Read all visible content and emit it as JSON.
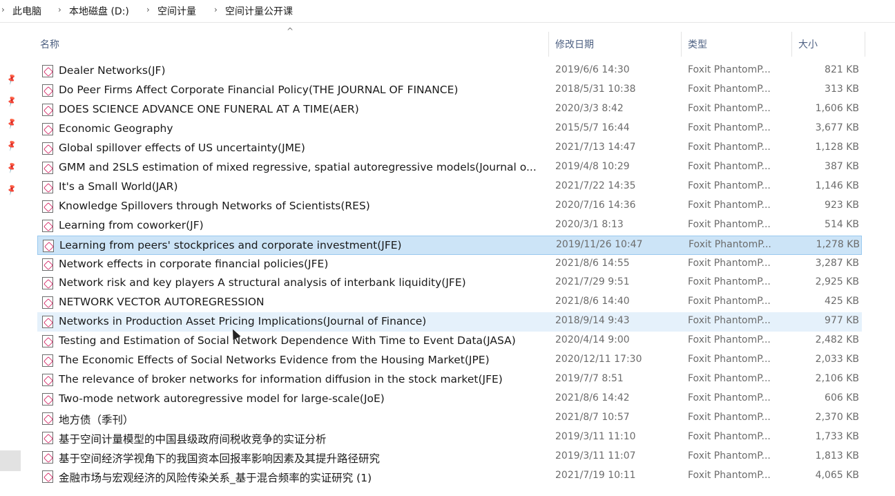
{
  "breadcrumb": [
    "此电脑",
    "本地磁盘 (D:)",
    "空间计量",
    "空间计量公开课"
  ],
  "columns": {
    "name": "名称",
    "date": "修改日期",
    "type": "类型",
    "size": "大小"
  },
  "files": [
    {
      "name": "Dealer Networks(JF)",
      "date": "2019/6/6 14:30",
      "type": "Foxit PhantomP...",
      "size": "821 KB"
    },
    {
      "name": "Do Peer Firms Affect Corporate Financial Policy(THE JOURNAL OF FINANCE)",
      "date": "2018/5/31 10:38",
      "type": "Foxit PhantomP...",
      "size": "313 KB"
    },
    {
      "name": "DOES SCIENCE ADVANCE ONE FUNERAL AT A TIME(AER)",
      "date": "2020/3/3 8:42",
      "type": "Foxit PhantomP...",
      "size": "1,606 KB"
    },
    {
      "name": "Economic Geography",
      "date": "2015/5/7 16:44",
      "type": "Foxit PhantomP...",
      "size": "3,677 KB"
    },
    {
      "name": "Global spillover effects of US uncertainty(JME)",
      "date": "2021/7/13 14:47",
      "type": "Foxit PhantomP...",
      "size": "1,128 KB"
    },
    {
      "name": "GMM and 2SLS estimation of mixed regressive, spatial autoregressive models(Journal o...",
      "date": "2019/4/8 10:29",
      "type": "Foxit PhantomP...",
      "size": "387 KB"
    },
    {
      "name": "It's a Small World(JAR)",
      "date": "2021/7/22 14:35",
      "type": "Foxit PhantomP...",
      "size": "1,146 KB"
    },
    {
      "name": "Knowledge Spillovers through Networks of Scientists(RES)",
      "date": "2020/7/16 14:36",
      "type": "Foxit PhantomP...",
      "size": "923 KB"
    },
    {
      "name": "Learning from coworker(JF)",
      "date": "2020/3/1 8:13",
      "type": "Foxit PhantomP...",
      "size": "514 KB"
    },
    {
      "name": "Learning from peers' stockprices and corporate investment(JFE)",
      "date": "2019/11/26 10:47",
      "type": "Foxit PhantomP...",
      "size": "1,278 KB"
    },
    {
      "name": "Network effects in corporate financial policies(JFE)",
      "date": "2021/8/6 14:55",
      "type": "Foxit PhantomP...",
      "size": "3,287 KB"
    },
    {
      "name": "Network risk and key players A structural analysis of interbank liquidity(JFE)",
      "date": "2021/7/29 9:51",
      "type": "Foxit PhantomP...",
      "size": "2,925 KB"
    },
    {
      "name": "NETWORK VECTOR AUTOREGRESSION",
      "date": "2021/8/6 14:40",
      "type": "Foxit PhantomP...",
      "size": "425 KB"
    },
    {
      "name": "Networks in Production Asset Pricing Implications(Journal of Finance)",
      "date": "2018/9/14 9:43",
      "type": "Foxit PhantomP...",
      "size": "977 KB"
    },
    {
      "name": "Testing and Estimation of Social Network Dependence With Time to Event Data(JASA)",
      "date": "2020/4/14 9:00",
      "type": "Foxit PhantomP...",
      "size": "2,482 KB"
    },
    {
      "name": "The Economic Effects of Social Networks Evidence from the Housing Market(JPE)",
      "date": "2020/12/11 17:30",
      "type": "Foxit PhantomP...",
      "size": "2,033 KB"
    },
    {
      "name": "The relevance of broker networks for information diffusion in the stock market(JFE)",
      "date": "2019/7/7 8:51",
      "type": "Foxit PhantomP...",
      "size": "2,106 KB"
    },
    {
      "name": "Two-mode network autoregressive model for large-scale(JoE)",
      "date": "2021/8/6 14:42",
      "type": "Foxit PhantomP...",
      "size": "606 KB"
    },
    {
      "name": "地方债（季刊）",
      "date": "2021/8/7 10:57",
      "type": "Foxit PhantomP...",
      "size": "2,370 KB"
    },
    {
      "name": "基于空间计量模型的中国县级政府间税收竞争的实证分析",
      "date": "2019/3/11 11:10",
      "type": "Foxit PhantomP...",
      "size": "1,733 KB"
    },
    {
      "name": "基于空间经济学视角下的我国资本回报率影响因素及其提升路径研究",
      "date": "2019/3/11 11:07",
      "type": "Foxit PhantomP...",
      "size": "1,813 KB"
    },
    {
      "name": "金融市场与宏观经济的风险传染关系_基于混合频率的实证研究 (1)",
      "date": "2021/7/19 10:11",
      "type": "Foxit PhantomP...",
      "size": "4,065 KB"
    }
  ],
  "selected_index": 9,
  "hover_index": 13
}
